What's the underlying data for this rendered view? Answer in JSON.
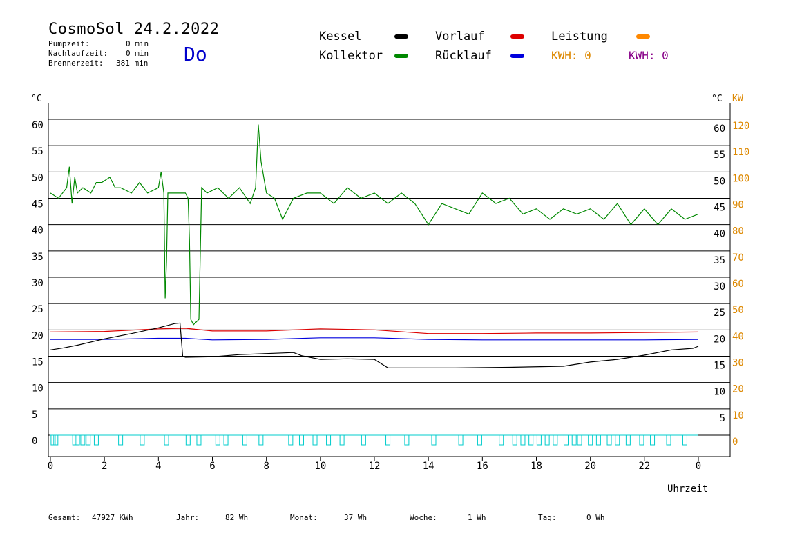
{
  "header": {
    "title": "CosmoSol 24.2.2022",
    "stats": [
      {
        "label": "Pumpzeit:",
        "value": "0 min"
      },
      {
        "label": "Nachlaufzeit:",
        "value": "0 min"
      },
      {
        "label": "Brennerzeit:",
        "value": "381 min"
      }
    ],
    "weekday": "Do"
  },
  "legend": {
    "items": [
      {
        "label": "Kessel",
        "color": "#000000"
      },
      {
        "label": "Vorlauf",
        "color": "#dd0000"
      },
      {
        "label": "Leistung",
        "color": "#ff8800"
      },
      {
        "label": "Kollektor",
        "color": "#008800"
      },
      {
        "label": "Rücklauf",
        "color": "#0000dd"
      }
    ],
    "kwh": [
      {
        "text": "KWH: 0",
        "color": "#dd8800"
      },
      {
        "text": "KWH: 0",
        "color": "#880088"
      }
    ]
  },
  "axes": {
    "left_unit": "°C",
    "right_unit_c": "°C",
    "right_unit_kw": "KW",
    "x_title": "Uhrzeit"
  },
  "footer": [
    {
      "label": "Gesamt:",
      "value": "47927 KWh"
    },
    {
      "label": "Jahr:",
      "value": "82 Wh"
    },
    {
      "label": "Monat:",
      "value": "37 Wh"
    },
    {
      "label": "Woche:",
      "value": "1 Wh"
    },
    {
      "label": "Tag:",
      "value": "0 Wh"
    }
  ],
  "chart_data": {
    "type": "line",
    "xlabel": "Uhrzeit",
    "ylabel": "°C",
    "x_ticks": [
      "0",
      "2",
      "4",
      "6",
      "8",
      "10",
      "12",
      "14",
      "16",
      "18",
      "20",
      "22",
      "0"
    ],
    "xlim": [
      0,
      24
    ],
    "ylim": [
      0,
      60
    ],
    "y_ticks_left": [
      0,
      5,
      10,
      15,
      20,
      25,
      30,
      35,
      40,
      45,
      50,
      55,
      60
    ],
    "y_ticks_right_c": [
      5,
      10,
      15,
      20,
      25,
      30,
      35,
      40,
      45,
      50,
      55,
      60
    ],
    "y_ticks_right_kw": [
      0,
      10,
      20,
      30,
      40,
      50,
      60,
      70,
      80,
      90,
      100,
      110,
      120
    ],
    "grid": true,
    "series": [
      {
        "name": "Kollektor",
        "color": "#008800",
        "x": [
          0,
          0.3,
          0.6,
          0.7,
          0.8,
          0.9,
          1.0,
          1.2,
          1.5,
          1.7,
          1.9,
          2.2,
          2.4,
          2.6,
          3.0,
          3.3,
          3.6,
          4.0,
          4.1,
          4.2,
          4.25,
          4.3,
          4.35,
          4.5,
          5.0,
          5.1,
          5.15,
          5.2,
          5.3,
          5.5,
          5.6,
          5.8,
          6.2,
          6.6,
          7.0,
          7.4,
          7.6,
          7.7,
          7.8,
          8.0,
          8.3,
          8.6,
          9.0,
          9.5,
          10.0,
          10.5,
          11.0,
          11.5,
          12.0,
          12.5,
          13.0,
          13.5,
          14.0,
          14.5,
          15.0,
          15.5,
          16.0,
          16.5,
          17.0,
          17.5,
          18.0,
          18.5,
          19.0,
          19.5,
          20.0,
          20.5,
          21.0,
          21.5,
          22.0,
          22.5,
          23.0,
          23.5,
          24.0
        ],
        "y": [
          46,
          45,
          47,
          51,
          44,
          49,
          46,
          47,
          46,
          48,
          48,
          49,
          47,
          47,
          46,
          48,
          46,
          47,
          50,
          46,
          26,
          33,
          46,
          46,
          46,
          45,
          37,
          22,
          21,
          22,
          47,
          46,
          47,
          45,
          47,
          44,
          47,
          59,
          52,
          46,
          45,
          41,
          45,
          46,
          46,
          44,
          47,
          45,
          46,
          44,
          46,
          44,
          40,
          44,
          43,
          42,
          46,
          44,
          45,
          42,
          43,
          41,
          43,
          42,
          43,
          41,
          44,
          40,
          43,
          40,
          43,
          41,
          42
        ]
      },
      {
        "name": "Vorlauf",
        "color": "#dd0000",
        "x": [
          0,
          2,
          4,
          5,
          6,
          8,
          10,
          12,
          14,
          16,
          18,
          20,
          22,
          24
        ],
        "y": [
          19.6,
          19.7,
          20.2,
          20.3,
          19.8,
          19.8,
          20.2,
          20.0,
          19.3,
          19.3,
          19.4,
          19.4,
          19.5,
          19.6
        ]
      },
      {
        "name": "Rücklauf",
        "color": "#0000dd",
        "x": [
          0,
          2,
          4,
          5,
          6,
          8,
          10,
          12,
          14,
          16,
          18,
          20,
          22,
          24
        ],
        "y": [
          18.2,
          18.2,
          18.4,
          18.4,
          18.1,
          18.2,
          18.5,
          18.5,
          18.2,
          18.1,
          18.1,
          18.1,
          18.1,
          18.2
        ]
      },
      {
        "name": "Kessel",
        "color": "#000000",
        "x": [
          0,
          0.5,
          1,
          2,
          3,
          4,
          4.6,
          4.8,
          4.9,
          5.0,
          6,
          7,
          8,
          9,
          9.3,
          10,
          11,
          12,
          12.5,
          13,
          15,
          17,
          19,
          20,
          21,
          22,
          23,
          23.8,
          24
        ],
        "y": [
          16.2,
          16.6,
          17.1,
          18.3,
          19.3,
          20.4,
          21.2,
          21.3,
          15.0,
          14.8,
          14.9,
          15.3,
          15.5,
          15.7,
          15.1,
          14.4,
          14.5,
          14.4,
          12.8,
          12.8,
          12.8,
          12.9,
          13.1,
          13.9,
          14.4,
          15.2,
          16.2,
          16.5,
          16.9
        ]
      },
      {
        "name": "Leistung",
        "color": "#00cccc",
        "x": [
          0.1,
          0.2,
          0.9,
          1.0,
          1.2,
          1.4,
          1.7,
          2.6,
          3.4,
          4.3,
          5.1,
          5.5,
          6.2,
          6.5,
          7.2,
          7.8,
          8.9,
          9.3,
          9.8,
          10.3,
          10.8,
          11.6,
          12.5,
          13.2,
          14.2,
          15.2,
          15.9,
          16.7,
          17.2,
          17.5,
          17.8,
          18.1,
          18.4,
          18.7,
          19.1,
          19.4,
          19.6,
          20.0,
          20.3,
          20.7,
          21.0,
          21.4,
          21.9,
          22.3,
          22.9,
          23.5
        ],
        "y": [
          0,
          0,
          0,
          0,
          0,
          0,
          0,
          0,
          0,
          0,
          0,
          0,
          0,
          0,
          0,
          0,
          0,
          0,
          0,
          0,
          0,
          0,
          0,
          0,
          0,
          0,
          0,
          0,
          0,
          0,
          0,
          0,
          0,
          0,
          0,
          0,
          0,
          0,
          0,
          0,
          0,
          0,
          0,
          0,
          0,
          0
        ]
      }
    ]
  }
}
